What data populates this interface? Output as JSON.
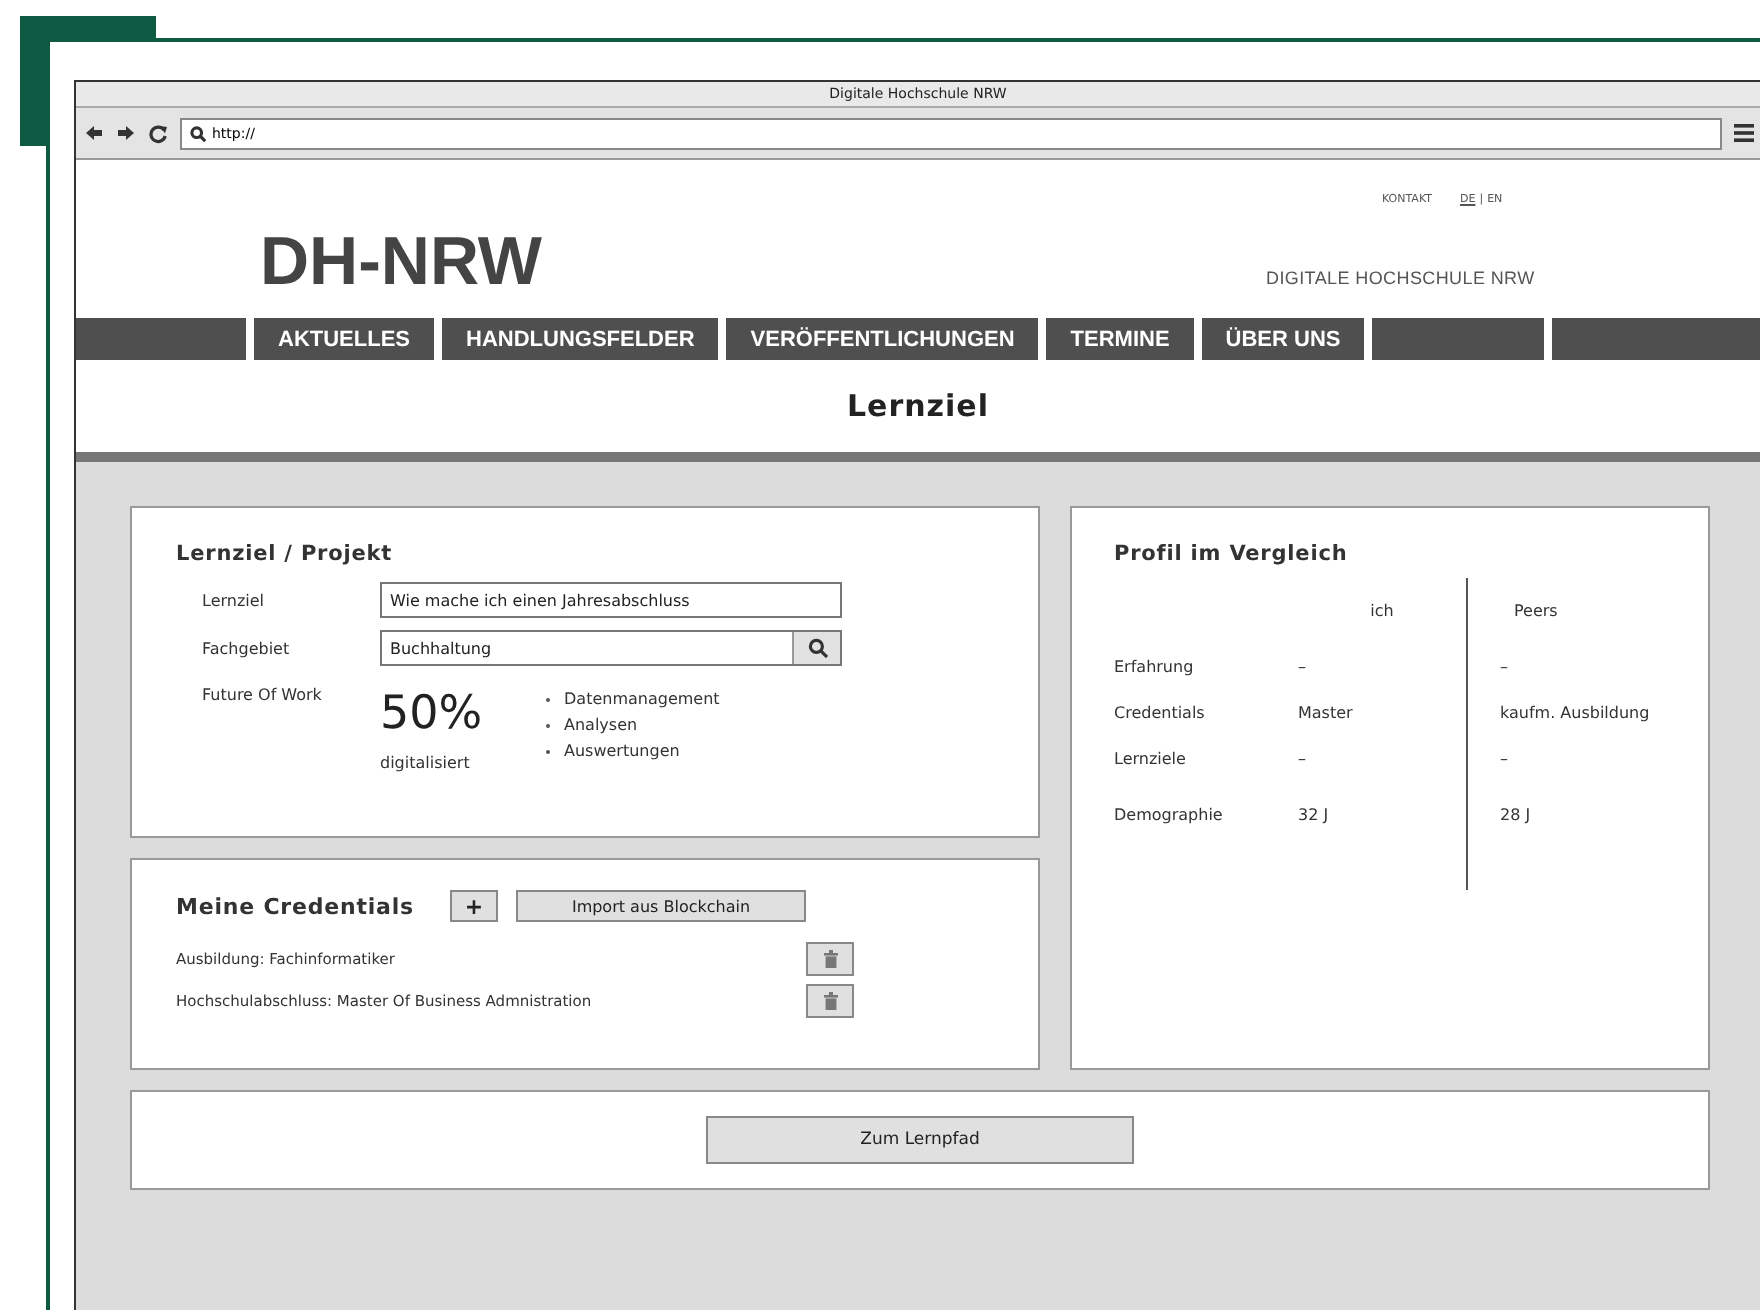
{
  "window": {
    "title": "Digitale Hochschule NRW"
  },
  "toolbar": {
    "url": "http://"
  },
  "header": {
    "contact": "KONTAKT",
    "language_switch": {
      "separator": "|",
      "options": [
        {
          "label": "DE",
          "selected": true
        },
        {
          "label": "EN",
          "selected": false
        }
      ]
    },
    "logo": "DH-NRW",
    "tagline": "DIGITALE HOCHSCHULE NRW"
  },
  "nav": {
    "items": [
      "AKTUELLES",
      "HANDLUNGSFELDER",
      "VERÖFFENTLICHUNGEN",
      "TERMINE",
      "ÜBER UNS"
    ]
  },
  "page_title": "Lernziel",
  "goal_panel": {
    "title": "Lernziel / Projekt",
    "fields": [
      {
        "label": "Lernziel",
        "value": "Wie mache ich einen Jahresabschluss",
        "kind": "text"
      },
      {
        "label": "Fachgebiet",
        "value": "Buchhaltung",
        "kind": "search"
      }
    ],
    "future_of_work": {
      "label": "Future Of Work",
      "percent": "50%",
      "caption": "digitalisiert",
      "bullets": [
        "Datenmanagement",
        "Analysen",
        "Auswertungen"
      ]
    }
  },
  "credentials_panel": {
    "title": "Meine Credentials",
    "add_button": "+",
    "import_button": "Import aus Blockchain",
    "items": [
      "Ausbildung: Fachinformatiker",
      "Hochschulabschluss: Master Of Business Admnistration"
    ]
  },
  "comparison_panel": {
    "title": "Profil im Vergleich",
    "columns": [
      "ich",
      "Peers"
    ],
    "rows": [
      {
        "label": "Erfahrung",
        "ich": "–",
        "peers": "–"
      },
      {
        "label": "Credentials",
        "ich": "Master",
        "peers": "kaufm. Ausbildung"
      },
      {
        "label": "Lernziele",
        "ich": "–",
        "peers": "–"
      },
      {
        "label": "Demographie",
        "ich": "32 J",
        "peers": "28 J"
      }
    ]
  },
  "action_button": "Zum Lernpfad"
}
